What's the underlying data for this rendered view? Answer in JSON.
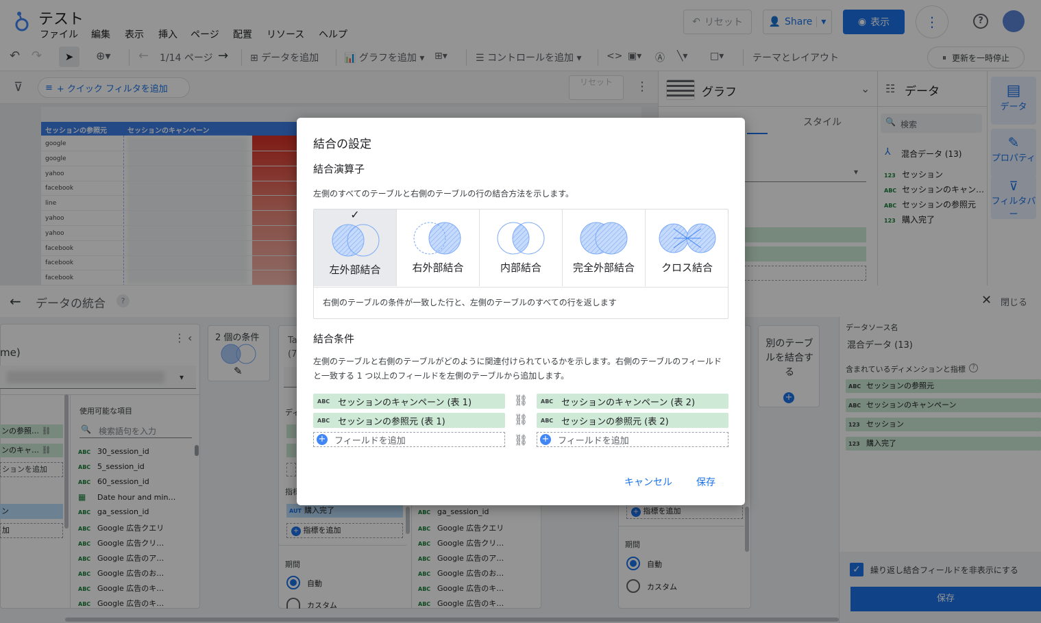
{
  "header": {
    "title": "テスト",
    "menus": [
      "ファイル",
      "編集",
      "表示",
      "挿入",
      "ページ",
      "配置",
      "リソース",
      "ヘルプ"
    ],
    "reset_label": "リセット",
    "share_label": "Share",
    "view_label": "表示"
  },
  "toolbar": {
    "page_indicator": "1/14 ページ",
    "add_data": "データを追加",
    "add_chart": "グラフを追加",
    "add_control": "コントロールを追加",
    "theme_layout": "テーマとレイアウト",
    "pause_updates": "更新を一時停止"
  },
  "filterbar": {
    "quick_filter": "+ クイック フィルタを追加",
    "reset": "リセット"
  },
  "table": {
    "headers": [
      "セッションの参照元",
      "セッションのキャンペーン"
    ],
    "rows": [
      "google",
      "google",
      "yahoo",
      "facebook",
      "line",
      "yahoo",
      "yahoo",
      "facebook",
      "facebook",
      "facebook"
    ]
  },
  "graph_panel": {
    "title": "グラフ",
    "tab_style": "スタイル"
  },
  "data_panel": {
    "title": "データ",
    "search_placeholder": "検索",
    "source": "混合データ (13)",
    "fields": [
      {
        "type": "123",
        "name": "セッション"
      },
      {
        "type": "ABC",
        "name": "セッションのキャン…"
      },
      {
        "type": "ABC",
        "name": "セッションの参照元"
      },
      {
        "type": "123",
        "name": "購入完了"
      }
    ]
  },
  "side_tabs": [
    "データ",
    "プロパティ",
    "フィルタバー"
  ],
  "blend": {
    "title": "データの統合",
    "close_label": "閉じる",
    "left_partial_name": "me)",
    "conditions_label": "2 個の条件",
    "add_table_label": "別のテーブルを結合する",
    "available_items_label": "使用可能な項目",
    "search_placeholder": "検索語句を入力",
    "left_dims": [
      "ンの参照…",
      "ンのキャ…"
    ],
    "left_add_dim": "ションを追加",
    "left_metric": "ン",
    "left_add": "加",
    "available_fields": [
      {
        "type": "ABC",
        "name": "30_session_id"
      },
      {
        "type": "ABC",
        "name": "5_session_id"
      },
      {
        "type": "ABC",
        "name": "60_session_id"
      },
      {
        "type": "CAL",
        "name": "Date hour and min…"
      },
      {
        "type": "ABC",
        "name": "ga_session_id"
      },
      {
        "type": "ABC",
        "name": "Google 広告クエリ"
      },
      {
        "type": "ABC",
        "name": "Google 広告クリ…"
      },
      {
        "type": "ABC",
        "name": "Google 広告のア…"
      },
      {
        "type": "ABC",
        "name": "Google 広告のお…"
      },
      {
        "type": "ABC",
        "name": "Google 広告のキ…"
      },
      {
        "type": "ABC",
        "name": "Google 広告のキ…"
      }
    ],
    "middle_fields": [
      {
        "type": "ABC",
        "name": "ga_session_id"
      },
      {
        "type": "ABC",
        "name": "Google 広告クエリ"
      },
      {
        "type": "ABC",
        "name": "Google 広告クリ…"
      },
      {
        "type": "ABC",
        "name": "Google 広告のア…"
      },
      {
        "type": "ABC",
        "name": "Google 広告のお…"
      },
      {
        "type": "ABC",
        "name": "Google 広告のキ…"
      },
      {
        "type": "ABC",
        "name": "Google 広告のキ…"
      }
    ],
    "middle_metric_type": "AUT",
    "middle_metric": "購入完了",
    "add_metric": "指標を追加",
    "metric_label": "指標",
    "period_label": "期間",
    "period_auto": "自動",
    "period_custom": "カスタム",
    "datasource_name_label": "データソース名",
    "datasource_name": "混合データ (13)",
    "included_label": "含まれているディメンションと指標",
    "included_fields": [
      {
        "type": "ABC",
        "name": "セッションの参照元"
      },
      {
        "type": "ABC",
        "name": "セッションのキャンペーン"
      },
      {
        "type": "123",
        "name": "セッション"
      },
      {
        "type": "123",
        "name": "購入完了"
      }
    ],
    "hide_repeat_label": "繰り返し結合フィールドを非表示にする",
    "save_label": "保存"
  },
  "dialog": {
    "title": "結合の設定",
    "operator_heading": "結合演算子",
    "operator_desc": "左側のすべてのテーブルと右側のテーブルの行の結合方法を示します。",
    "options": [
      "左外部結合",
      "右外部結合",
      "内部結合",
      "完全外部結合",
      "クロス結合"
    ],
    "selected_index": 0,
    "option_desc": "右側のテーブルの条件が一致した行と、左側のテーブルのすべての行を返します",
    "conditions_heading": "結合条件",
    "conditions_desc": "左側のテーブルと右側のテーブルがどのように関連付けられているかを示します。右側のテーブルのフィールドと一致する 1 つ以上のフィールドを左側のテーブルから追加します。",
    "left_fields": [
      "セッションのキャンペーン (表 1)",
      "セッションの参照元 (表 1)"
    ],
    "right_fields": [
      "セッションのキャンペーン (表 2)",
      "セッションの参照元 (表 2)"
    ],
    "field_type": "ABC",
    "add_field": "フィールドを追加",
    "cancel_label": "キャンセル",
    "save_label": "保存"
  },
  "colors": {
    "accent": "#1a73e8",
    "join_fill": "#aecbfa",
    "green_chip": "#ceead6"
  }
}
